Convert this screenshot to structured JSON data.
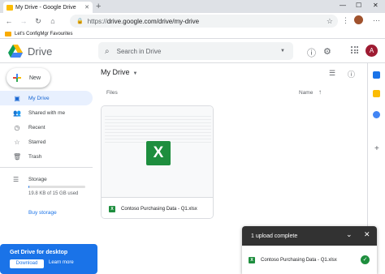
{
  "browser": {
    "tab_title": "My Drive - Google Drive",
    "url_protocol": "https://",
    "url_rest": "drive.google.com/drive/my-drive",
    "bookmark": "Let's ConfigMgr Favourites"
  },
  "header": {
    "brand": "Drive",
    "search_placeholder": "Search in Drive",
    "account_initial": "A"
  },
  "sidebar": {
    "new_label": "New",
    "items": [
      {
        "label": "My Drive",
        "icon": "drive-icon"
      },
      {
        "label": "Shared with me",
        "icon": "people-icon"
      },
      {
        "label": "Recent",
        "icon": "clock-icon"
      },
      {
        "label": "Starred",
        "icon": "star-icon"
      },
      {
        "label": "Trash",
        "icon": "trash-icon"
      }
    ],
    "storage_label": "Storage",
    "storage_text": "19.8 KB of 15 GB used",
    "storage_fraction": 0.01,
    "buy_storage": "Buy storage"
  },
  "promo": {
    "title": "Get Drive for desktop",
    "download": "Download",
    "learn_more": "Learn more"
  },
  "main": {
    "title": "My Drive",
    "files_label": "Files",
    "name_label": "Name",
    "file_name": "Contoso Purchasing Data - Q1.xlsx",
    "file_badge": "X"
  },
  "toast": {
    "title": "1 upload complete",
    "file_name": "Contoso Purchasing Data - Q1.xlsx"
  },
  "colors": {
    "accent": "#1a73e8",
    "excel_green": "#1e8e3e",
    "active_bg": "#e8f0fe"
  }
}
